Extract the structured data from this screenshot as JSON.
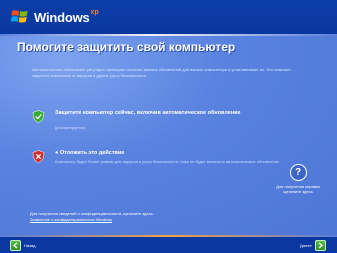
{
  "brand": {
    "name": "Windows",
    "edition": "xp",
    "colors": {
      "band": "#0a38a0",
      "panel": "#5a7edc",
      "accent": "#f08030"
    }
  },
  "page": {
    "title": "Помогите защитить свой компьютер",
    "intro": "Автоматическое обновление регулярно проверяет наличие важных обновлений для вашего компьютера и устанавливает их. Это помогает защитить компьютер от вирусов и других угроз безопасности."
  },
  "options": [
    {
      "icon": "shield-check-icon",
      "heading": "Защитите компьютер сейчас, включив автоматическое обновление",
      "subtext": "(рекомендуется)"
    },
    {
      "icon": "shield-x-icon",
      "heading": "Отложить это действие",
      "subtext": "Компьютер будет более уязвим для вирусов и угроз безопасности, пока не будет включено автоматическое обновление."
    }
  ],
  "help": {
    "icon": "question-icon",
    "text": "Для получения справки щелкните здесь"
  },
  "footnote": {
    "text": "Для получения сведений о конфиденциальности, щелкните здесь.",
    "link": "Заявление о конфиденциальности Windows"
  },
  "nav": {
    "back_label": "Назад",
    "next_label": "Далее"
  }
}
